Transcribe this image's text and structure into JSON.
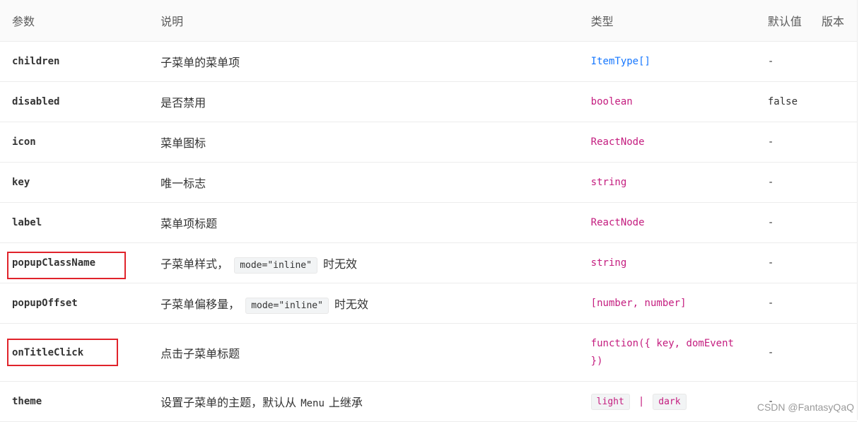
{
  "header": {
    "param": "参数",
    "desc": "说明",
    "type": "类型",
    "default": "默认值",
    "version": "版本"
  },
  "rows": [
    {
      "name": "children",
      "desc": "子菜单的菜单项",
      "type": "ItemType[]",
      "default": "-"
    },
    {
      "name": "disabled",
      "desc": "是否禁用",
      "type": "boolean",
      "default": "false"
    },
    {
      "name": "icon",
      "desc": "菜单图标",
      "type": "ReactNode",
      "default": "-"
    },
    {
      "name": "key",
      "desc": "唯一标志",
      "type": "string",
      "default": "-"
    },
    {
      "name": "label",
      "desc": "菜单项标题",
      "type": "ReactNode",
      "default": "-"
    },
    {
      "name": "popupClassName",
      "desc_before": "子菜单样式，",
      "desc_code": "mode=\"inline\"",
      "desc_after": "时无效",
      "type": "string",
      "default": "-"
    },
    {
      "name": "popupOffset",
      "desc_before": "子菜单偏移量，",
      "desc_code": "mode=\"inline\"",
      "desc_after": "时无效",
      "type": "[number, number]",
      "default": "-"
    },
    {
      "name": "onTitleClick",
      "desc": "点击子菜单标题",
      "type_line1": "function({ key, domEvent",
      "type_line2": "})",
      "default": "-"
    },
    {
      "name": "theme",
      "desc_before": "设置子菜单的主题，默认从",
      "desc_code": "Menu",
      "desc_after": "上继承",
      "type_tag1": "light",
      "type_sep": "|",
      "type_tag2": "dark",
      "default": "-"
    }
  ],
  "highlight_color": "#e0232b",
  "watermark": "CSDN @FantasyQaQ"
}
